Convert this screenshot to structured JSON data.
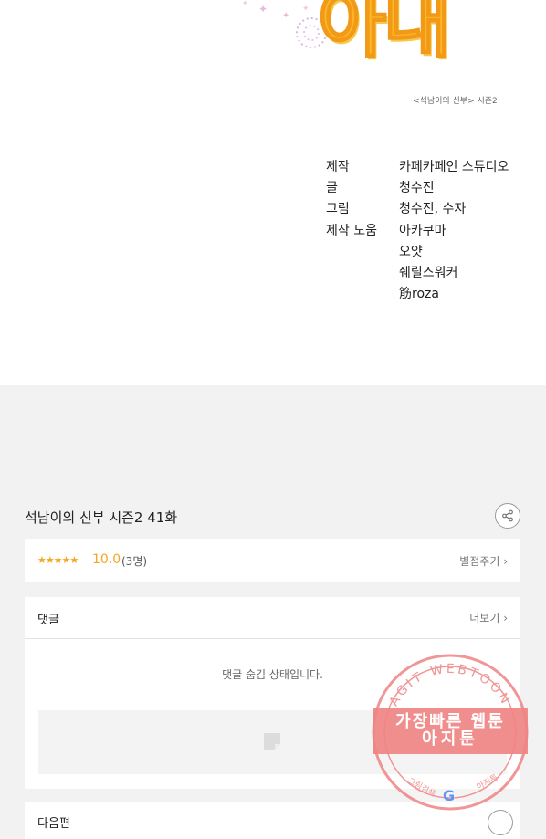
{
  "header": {
    "title_art": "아내",
    "series_subtitle": "<석남이의 신부> 시즌2"
  },
  "credits": [
    {
      "role": "제작",
      "name": "카페카페인 스튜디오"
    },
    {
      "role": "글",
      "name": "청수진"
    },
    {
      "role": "그림",
      "name": "청수진, 수자"
    },
    {
      "role": "제작 도움",
      "name": "아카쿠마"
    },
    {
      "role": "",
      "name": "오얏"
    },
    {
      "role": "",
      "name": "쉐릴스워커"
    },
    {
      "role": "",
      "name": "筋roza"
    }
  ],
  "episode": {
    "title": "석남이의 신부 시즌2 41화"
  },
  "rating": {
    "stars": "★★★★★",
    "score": "10.0",
    "votes": "(3명)",
    "rate_label": "별점주기 ›"
  },
  "comments": {
    "label": "댓글",
    "more_label": "더보기 ›",
    "hidden_message": "댓글 숨김 상태입니다."
  },
  "next": {
    "label": "다음편"
  },
  "watermark": {
    "ring_text": "AGIT WEBTOON",
    "line1": "가장빠른 웹툰",
    "line2": "아지툰",
    "bottom_left": "그림검색",
    "bottom_right": "아지툰",
    "accent_color": "#ef8484"
  }
}
